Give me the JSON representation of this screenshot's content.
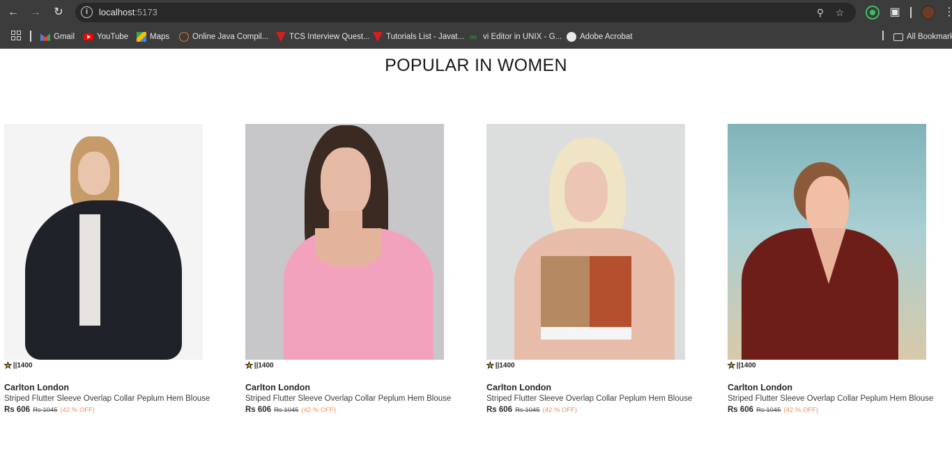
{
  "browser": {
    "url_host": "localhost",
    "url_port": ":5173",
    "bookmarks": [
      {
        "label": "Gmail",
        "icon": "gmail-icon"
      },
      {
        "label": "YouTube",
        "icon": "youtube-icon"
      },
      {
        "label": "Maps",
        "icon": "maps-icon"
      },
      {
        "label": "Online Java Compil...",
        "icon": "java-compiler-icon"
      },
      {
        "label": "TCS Interview Quest...",
        "icon": "heart-icon"
      },
      {
        "label": "Tutorials List - Javat...",
        "icon": "heart-icon"
      },
      {
        "label": "vi Editor in UNIX - G...",
        "icon": "vi-editor-icon"
      },
      {
        "label": "Adobe Acrobat",
        "icon": "acrobat-icon"
      }
    ],
    "all_bookmarks": "All Bookmarks"
  },
  "page": {
    "title": "POPULAR IN WOMEN"
  },
  "products": [
    {
      "rating": "||1400",
      "brand": "Carlton London",
      "description": "Striped Flutter Sleeve Overlap Collar Peplum Hem Blouse",
      "price": "Rs 606",
      "mrp": "Rs 1045",
      "discount": "(42 % OFF)",
      "image": "woman-fur-jacket-photo"
    },
    {
      "rating": "||1400",
      "brand": "Carlton London",
      "description": "Striped Flutter Sleeve Overlap Collar Peplum Hem Blouse",
      "price": "Rs 606",
      "mrp": "Rs 1045",
      "discount": "(42 % OFF)",
      "image": "woman-pink-top-photo"
    },
    {
      "rating": "||1400",
      "brand": "Carlton London",
      "description": "Striped Flutter Sleeve Overlap Collar Peplum Hem Blouse",
      "price": "Rs 606",
      "mrp": "Rs 1045",
      "discount": "(42 % OFF)",
      "image": "woman-sports-top-photo"
    },
    {
      "rating": "||1400",
      "brand": "Carlton London",
      "description": "Striped Flutter Sleeve Overlap Collar Peplum Hem Blouse",
      "price": "Rs 606",
      "mrp": "Rs 1045",
      "discount": "(42 % OFF)",
      "image": "woman-red-dress-photo"
    }
  ]
}
